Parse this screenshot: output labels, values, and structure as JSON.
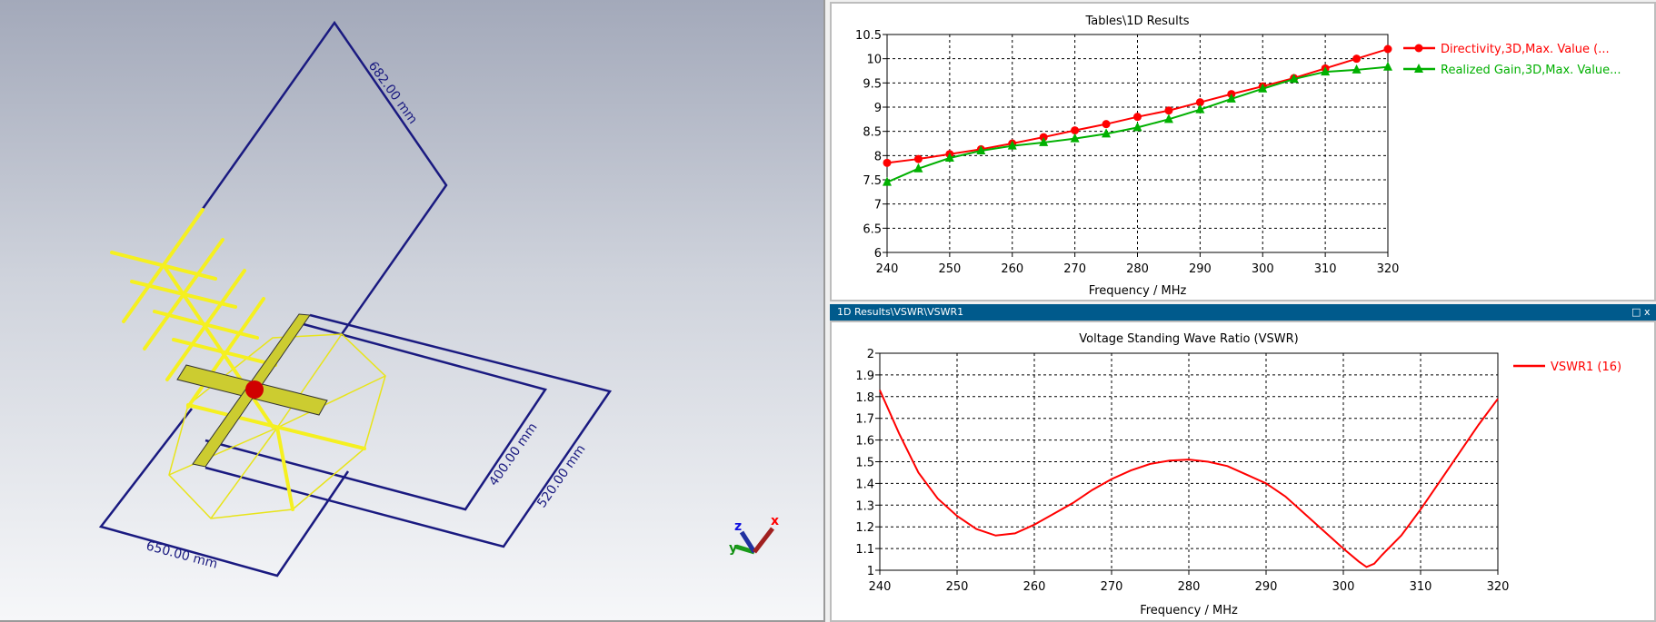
{
  "view3d": {
    "dimensions": [
      "682.00 mm",
      "650.00 mm",
      "400.00 mm",
      "520.00 mm"
    ],
    "axes": {
      "x": "x",
      "y": "y",
      "z": "z"
    }
  },
  "window_bottom": {
    "title": "1D Results\\VSWR\\VSWR1",
    "maximize_icon": "maximize-icon",
    "close_icon": "close-icon",
    "close_label": "x"
  },
  "colors": {
    "directivity": "#ff0000",
    "gain": "#00b000",
    "vswr": "#ff0000",
    "dim": "#1a1a80",
    "antenna": "#f5f020"
  },
  "chart_data": [
    {
      "type": "line",
      "title": "Tables\\1D Results",
      "xlabel": "Frequency / MHz",
      "ylabel": "",
      "xlim": [
        240,
        320
      ],
      "ylim": [
        6,
        10.5
      ],
      "xticks": [
        240,
        250,
        260,
        270,
        280,
        290,
        300,
        310,
        320
      ],
      "yticks": [
        "6",
        "6.5",
        "7",
        "7.5",
        "8",
        "8.5",
        "9",
        "9.5",
        "10",
        "10.5"
      ],
      "grid": true,
      "legend": "right",
      "x": [
        240,
        245,
        250,
        255,
        260,
        265,
        270,
        275,
        280,
        285,
        290,
        295,
        300,
        305,
        310,
        315,
        320
      ],
      "series": [
        {
          "name": "Directivity,3D,Max. Value (...",
          "marker": "circle",
          "color": "#ff0000",
          "values": [
            7.85,
            7.93,
            8.03,
            8.13,
            8.25,
            8.38,
            8.52,
            8.65,
            8.8,
            8.93,
            9.1,
            9.27,
            9.43,
            9.6,
            9.8,
            10.0,
            10.2
          ]
        },
        {
          "name": "Realized Gain,3D,Max. Value...",
          "marker": "triangle",
          "color": "#00b000",
          "values": [
            7.45,
            7.73,
            7.95,
            8.1,
            8.2,
            8.27,
            8.35,
            8.45,
            8.58,
            8.75,
            8.95,
            9.17,
            9.38,
            9.58,
            9.73,
            9.77,
            9.83
          ]
        }
      ]
    },
    {
      "type": "line",
      "title": "Voltage Standing Wave Ratio (VSWR)",
      "xlabel": "Frequency / MHz",
      "ylabel": "",
      "xlim": [
        240,
        320
      ],
      "ylim": [
        1,
        2
      ],
      "xticks": [
        240,
        250,
        260,
        270,
        280,
        290,
        300,
        310,
        320
      ],
      "yticks": [
        "1",
        "1.1",
        "1.2",
        "1.3",
        "1.4",
        "1.5",
        "1.6",
        "1.7",
        "1.8",
        "1.9",
        "2"
      ],
      "grid": true,
      "legend": "right",
      "x": [
        240,
        242.5,
        245,
        247.5,
        250,
        252.5,
        255,
        257.5,
        260,
        262.5,
        265,
        267.5,
        270,
        272.5,
        275,
        277.5,
        280,
        282.5,
        285,
        287.5,
        290,
        292.5,
        295,
        297.5,
        300,
        302,
        303,
        304,
        305,
        307.5,
        310,
        312.5,
        315,
        317.5,
        320
      ],
      "series": [
        {
          "name": "VSWR1 (16)",
          "marker": "none",
          "color": "#ff0000",
          "values": [
            1.83,
            1.63,
            1.45,
            1.33,
            1.25,
            1.19,
            1.16,
            1.17,
            1.21,
            1.26,
            1.31,
            1.37,
            1.42,
            1.46,
            1.49,
            1.505,
            1.51,
            1.5,
            1.48,
            1.44,
            1.4,
            1.34,
            1.26,
            1.18,
            1.1,
            1.04,
            1.015,
            1.03,
            1.07,
            1.16,
            1.28,
            1.41,
            1.54,
            1.67,
            1.79
          ]
        }
      ]
    }
  ]
}
